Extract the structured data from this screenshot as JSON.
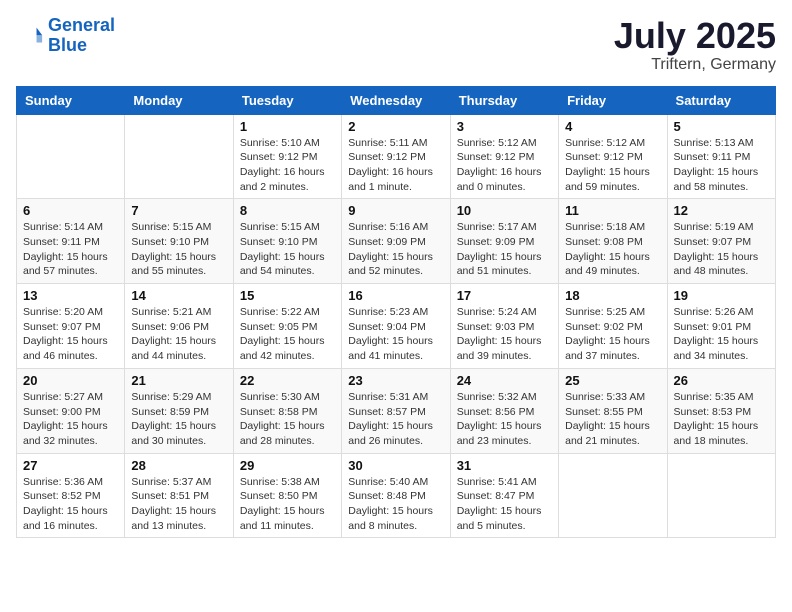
{
  "logo": {
    "line1": "General",
    "line2": "Blue"
  },
  "title": "July 2025",
  "subtitle": "Triftern, Germany",
  "days_of_week": [
    "Sunday",
    "Monday",
    "Tuesday",
    "Wednesday",
    "Thursday",
    "Friday",
    "Saturday"
  ],
  "weeks": [
    [
      {
        "day": "",
        "info": ""
      },
      {
        "day": "",
        "info": ""
      },
      {
        "day": "1",
        "info": "Sunrise: 5:10 AM\nSunset: 9:12 PM\nDaylight: 16 hours\nand 2 minutes."
      },
      {
        "day": "2",
        "info": "Sunrise: 5:11 AM\nSunset: 9:12 PM\nDaylight: 16 hours\nand 1 minute."
      },
      {
        "day": "3",
        "info": "Sunrise: 5:12 AM\nSunset: 9:12 PM\nDaylight: 16 hours\nand 0 minutes."
      },
      {
        "day": "4",
        "info": "Sunrise: 5:12 AM\nSunset: 9:12 PM\nDaylight: 15 hours\nand 59 minutes."
      },
      {
        "day": "5",
        "info": "Sunrise: 5:13 AM\nSunset: 9:11 PM\nDaylight: 15 hours\nand 58 minutes."
      }
    ],
    [
      {
        "day": "6",
        "info": "Sunrise: 5:14 AM\nSunset: 9:11 PM\nDaylight: 15 hours\nand 57 minutes."
      },
      {
        "day": "7",
        "info": "Sunrise: 5:15 AM\nSunset: 9:10 PM\nDaylight: 15 hours\nand 55 minutes."
      },
      {
        "day": "8",
        "info": "Sunrise: 5:15 AM\nSunset: 9:10 PM\nDaylight: 15 hours\nand 54 minutes."
      },
      {
        "day": "9",
        "info": "Sunrise: 5:16 AM\nSunset: 9:09 PM\nDaylight: 15 hours\nand 52 minutes."
      },
      {
        "day": "10",
        "info": "Sunrise: 5:17 AM\nSunset: 9:09 PM\nDaylight: 15 hours\nand 51 minutes."
      },
      {
        "day": "11",
        "info": "Sunrise: 5:18 AM\nSunset: 9:08 PM\nDaylight: 15 hours\nand 49 minutes."
      },
      {
        "day": "12",
        "info": "Sunrise: 5:19 AM\nSunset: 9:07 PM\nDaylight: 15 hours\nand 48 minutes."
      }
    ],
    [
      {
        "day": "13",
        "info": "Sunrise: 5:20 AM\nSunset: 9:07 PM\nDaylight: 15 hours\nand 46 minutes."
      },
      {
        "day": "14",
        "info": "Sunrise: 5:21 AM\nSunset: 9:06 PM\nDaylight: 15 hours\nand 44 minutes."
      },
      {
        "day": "15",
        "info": "Sunrise: 5:22 AM\nSunset: 9:05 PM\nDaylight: 15 hours\nand 42 minutes."
      },
      {
        "day": "16",
        "info": "Sunrise: 5:23 AM\nSunset: 9:04 PM\nDaylight: 15 hours\nand 41 minutes."
      },
      {
        "day": "17",
        "info": "Sunrise: 5:24 AM\nSunset: 9:03 PM\nDaylight: 15 hours\nand 39 minutes."
      },
      {
        "day": "18",
        "info": "Sunrise: 5:25 AM\nSunset: 9:02 PM\nDaylight: 15 hours\nand 37 minutes."
      },
      {
        "day": "19",
        "info": "Sunrise: 5:26 AM\nSunset: 9:01 PM\nDaylight: 15 hours\nand 34 minutes."
      }
    ],
    [
      {
        "day": "20",
        "info": "Sunrise: 5:27 AM\nSunset: 9:00 PM\nDaylight: 15 hours\nand 32 minutes."
      },
      {
        "day": "21",
        "info": "Sunrise: 5:29 AM\nSunset: 8:59 PM\nDaylight: 15 hours\nand 30 minutes."
      },
      {
        "day": "22",
        "info": "Sunrise: 5:30 AM\nSunset: 8:58 PM\nDaylight: 15 hours\nand 28 minutes."
      },
      {
        "day": "23",
        "info": "Sunrise: 5:31 AM\nSunset: 8:57 PM\nDaylight: 15 hours\nand 26 minutes."
      },
      {
        "day": "24",
        "info": "Sunrise: 5:32 AM\nSunset: 8:56 PM\nDaylight: 15 hours\nand 23 minutes."
      },
      {
        "day": "25",
        "info": "Sunrise: 5:33 AM\nSunset: 8:55 PM\nDaylight: 15 hours\nand 21 minutes."
      },
      {
        "day": "26",
        "info": "Sunrise: 5:35 AM\nSunset: 8:53 PM\nDaylight: 15 hours\nand 18 minutes."
      }
    ],
    [
      {
        "day": "27",
        "info": "Sunrise: 5:36 AM\nSunset: 8:52 PM\nDaylight: 15 hours\nand 16 minutes."
      },
      {
        "day": "28",
        "info": "Sunrise: 5:37 AM\nSunset: 8:51 PM\nDaylight: 15 hours\nand 13 minutes."
      },
      {
        "day": "29",
        "info": "Sunrise: 5:38 AM\nSunset: 8:50 PM\nDaylight: 15 hours\nand 11 minutes."
      },
      {
        "day": "30",
        "info": "Sunrise: 5:40 AM\nSunset: 8:48 PM\nDaylight: 15 hours\nand 8 minutes."
      },
      {
        "day": "31",
        "info": "Sunrise: 5:41 AM\nSunset: 8:47 PM\nDaylight: 15 hours\nand 5 minutes."
      },
      {
        "day": "",
        "info": ""
      },
      {
        "day": "",
        "info": ""
      }
    ]
  ]
}
